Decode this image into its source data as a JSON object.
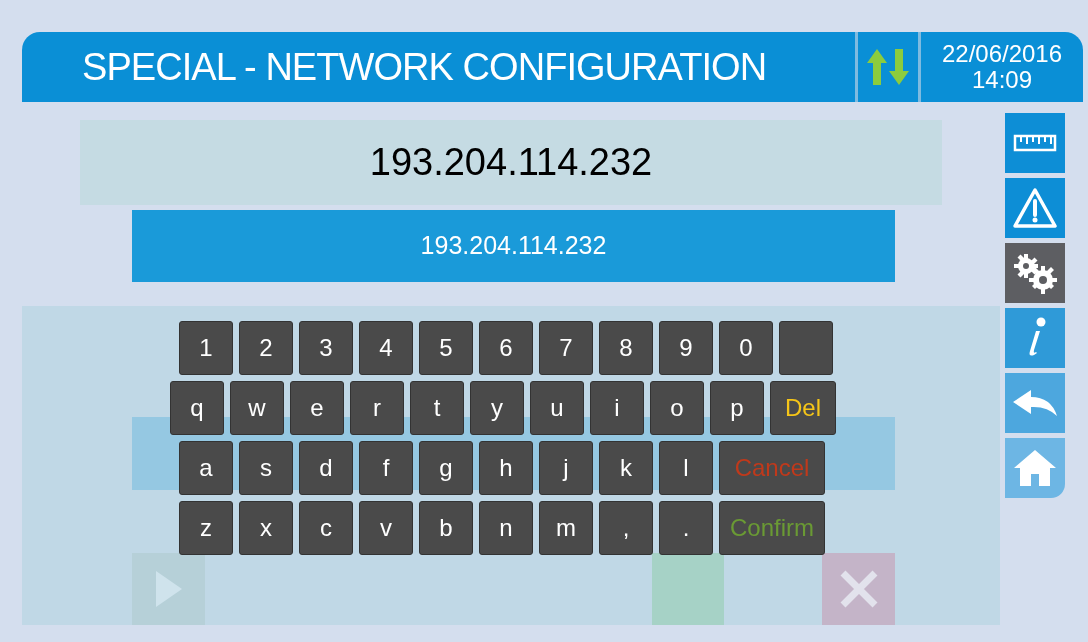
{
  "header": {
    "title": "SPECIAL - NETWORK CONFIGURATION",
    "date": "22/06/2016",
    "time": "14:09"
  },
  "address_display": "193.204.114.232",
  "address_input": {
    "value": "193.204.114.232"
  },
  "keyboard": {
    "rows": [
      [
        {
          "kind": "char",
          "label": "1"
        },
        {
          "kind": "char",
          "label": "2"
        },
        {
          "kind": "char",
          "label": "3"
        },
        {
          "kind": "char",
          "label": "4"
        },
        {
          "kind": "char",
          "label": "5"
        },
        {
          "kind": "char",
          "label": "6"
        },
        {
          "kind": "char",
          "label": "7"
        },
        {
          "kind": "char",
          "label": "8"
        },
        {
          "kind": "char",
          "label": "9"
        },
        {
          "kind": "char",
          "label": "0"
        },
        {
          "kind": "blank"
        }
      ],
      [
        {
          "kind": "char",
          "label": "q"
        },
        {
          "kind": "char",
          "label": "w"
        },
        {
          "kind": "char",
          "label": "e"
        },
        {
          "kind": "char",
          "label": "r"
        },
        {
          "kind": "char",
          "label": "t"
        },
        {
          "kind": "char",
          "label": "y"
        },
        {
          "kind": "char",
          "label": "u"
        },
        {
          "kind": "char",
          "label": "i"
        },
        {
          "kind": "char",
          "label": "o"
        },
        {
          "kind": "char",
          "label": "p"
        },
        {
          "kind": "action",
          "label": "Del",
          "color": "#f5c518"
        }
      ],
      [
        {
          "kind": "char",
          "label": "a"
        },
        {
          "kind": "char",
          "label": "s"
        },
        {
          "kind": "char",
          "label": "d"
        },
        {
          "kind": "char",
          "label": "f"
        },
        {
          "kind": "char",
          "label": "g"
        },
        {
          "kind": "char",
          "label": "h"
        },
        {
          "kind": "char",
          "label": "j"
        },
        {
          "kind": "char",
          "label": "k"
        },
        {
          "kind": "char",
          "label": "l"
        },
        {
          "kind": "action",
          "label": "Cancel",
          "color": "#c0391b"
        }
      ],
      [
        {
          "kind": "char",
          "label": "z"
        },
        {
          "kind": "char",
          "label": "x"
        },
        {
          "kind": "char",
          "label": "c"
        },
        {
          "kind": "char",
          "label": "v"
        },
        {
          "kind": "char",
          "label": "b"
        },
        {
          "kind": "char",
          "label": "n"
        },
        {
          "kind": "char",
          "label": "m"
        },
        {
          "kind": "char",
          "label": ","
        },
        {
          "kind": "char",
          "label": "."
        },
        {
          "kind": "action",
          "label": "Confirm",
          "color": "#6a9a34"
        }
      ]
    ]
  },
  "sidebar": {
    "items": [
      {
        "kind": "ruler",
        "selected": false
      },
      {
        "kind": "warning",
        "selected": false
      },
      {
        "kind": "gears",
        "selected": true
      },
      {
        "kind": "info",
        "selected": false
      },
      {
        "kind": "back",
        "selected": false
      },
      {
        "kind": "home",
        "selected": false
      }
    ]
  }
}
